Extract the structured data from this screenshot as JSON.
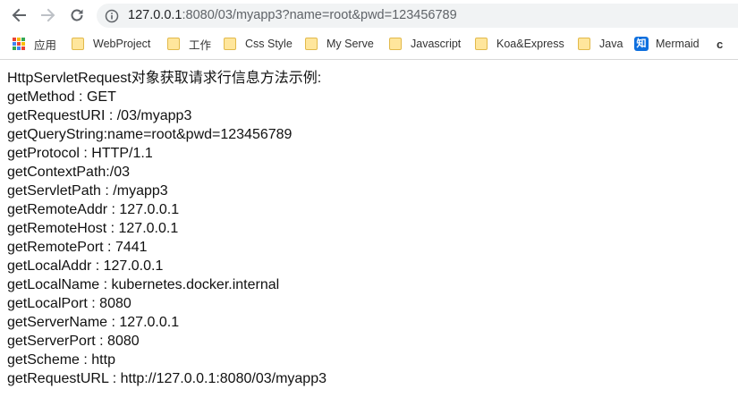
{
  "browser": {
    "url_host": "127.0.0.1",
    "url_rest": ":8080/03/myapp3?name=root&pwd=123456789"
  },
  "bookmarks": [
    {
      "label": "应用",
      "icon": "apps-grid-icon"
    },
    {
      "label": "WebProject",
      "icon": "folder-icon"
    },
    {
      "label": "工作",
      "icon": "folder-icon"
    },
    {
      "label": "Css Style",
      "icon": "folder-icon"
    },
    {
      "label": "My Serve",
      "icon": "folder-icon"
    },
    {
      "label": "Javascript",
      "icon": "folder-icon"
    },
    {
      "label": "Koa&Express",
      "icon": "folder-icon"
    },
    {
      "label": "Java",
      "icon": "folder-icon"
    },
    {
      "label": "Mermaid",
      "icon": "zhihu-icon",
      "icon_text": "知"
    }
  ],
  "bookmark_tail": "c",
  "page": {
    "lines": [
      "HttpServletRequest对象获取请求行信息方法示例:",
      "getMethod : GET",
      "getRequestURI : /03/myapp3",
      "getQueryString:name=root&pwd=123456789",
      "getProtocol : HTTP/1.1",
      "getContextPath:/03",
      "getServletPath : /myapp3",
      "getRemoteAddr : 127.0.0.1",
      "getRemoteHost : 127.0.0.1",
      "getRemotePort : 7441",
      "getLocalAddr : 127.0.0.1",
      "getLocalName : kubernetes.docker.internal",
      "getLocalPort : 8080",
      "getServerName : 127.0.0.1",
      "getServerPort : 8080",
      "getScheme : http",
      "getRequestURL : http://127.0.0.1:8080/03/myapp3"
    ]
  },
  "colors": {
    "folder_fill": "#ffe69c",
    "zhihu_blue": "#0e6fde",
    "omnibox_bg": "#f1f3f4"
  }
}
